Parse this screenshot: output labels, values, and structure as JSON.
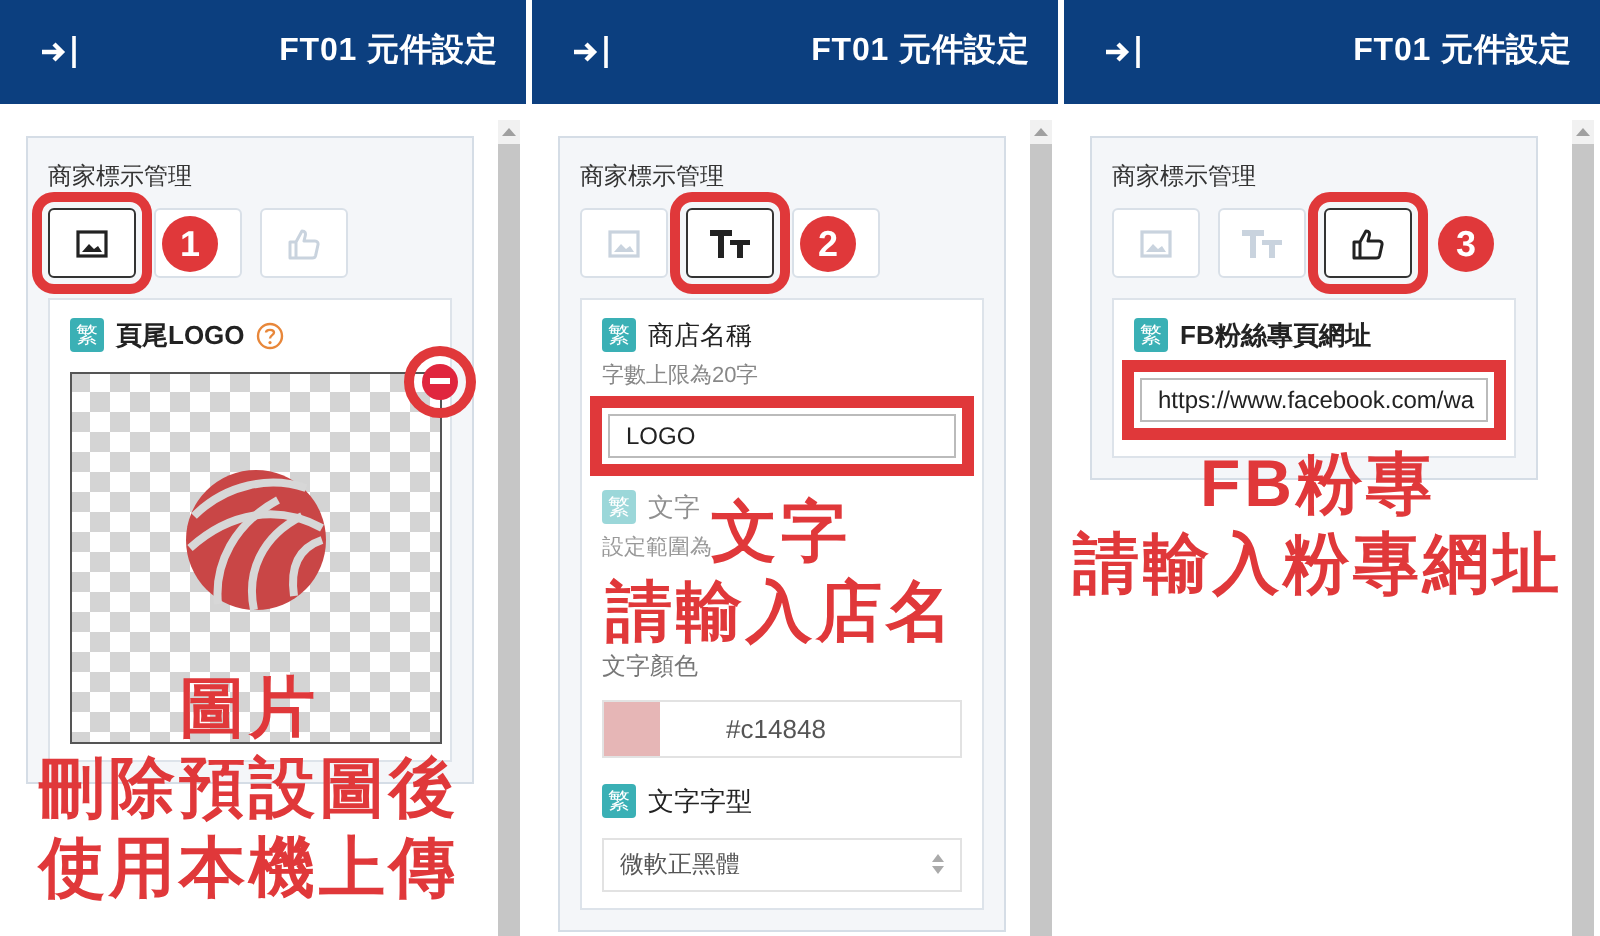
{
  "panels": [
    {
      "header_title": "FT01 元件設定",
      "section_title": "商家標示管理",
      "step": "1",
      "tabs": [
        {
          "kind": "image",
          "selected": true
        },
        {
          "kind": "text",
          "selected": false
        },
        {
          "kind": "like",
          "selected": false
        }
      ],
      "fields": [
        {
          "kind": "image_upload",
          "tag": "繁",
          "label": "頁尾LOGO",
          "strong": true,
          "help": true,
          "highlighted": true
        }
      ],
      "captions": [
        "圖片",
        "刪除預設圖後",
        "使用本機上傳"
      ]
    },
    {
      "header_title": "FT01 元件設定",
      "section_title": "商家標示管理",
      "step": "2",
      "tabs": [
        {
          "kind": "image",
          "selected": false
        },
        {
          "kind": "text",
          "selected": true
        },
        {
          "kind": "like",
          "selected": false
        }
      ],
      "fields": [
        {
          "kind": "text_input",
          "tag": "繁",
          "label": "商店名稱",
          "strong": false,
          "hint": "字數上限為20字",
          "value": "LOGO",
          "highlighted": true
        },
        {
          "kind": "number",
          "tag": "繁",
          "label": "文字",
          "strong": false,
          "hint": "設定範圍為",
          "disabled": true
        },
        {
          "kind": "color",
          "label": "文字顏色",
          "value": "#c14848"
        },
        {
          "kind": "select",
          "tag": "繁",
          "label": "文字字型",
          "strong": false,
          "value": "微軟正黑體"
        }
      ],
      "captions": [
        "文字",
        "請輸入店名"
      ]
    },
    {
      "header_title": "FT01 元件設定",
      "section_title": "商家標示管理",
      "step": "3",
      "tabs": [
        {
          "kind": "image",
          "selected": false
        },
        {
          "kind": "text",
          "selected": false
        },
        {
          "kind": "like",
          "selected": true
        }
      ],
      "fields": [
        {
          "kind": "text_input",
          "tag": "繁",
          "label": "FB粉絲專頁網址",
          "strong": true,
          "value": "https://www.facebook.com/wa",
          "highlighted": true
        }
      ],
      "captions": [
        "FB粉專",
        "請輸入粉專網址"
      ]
    }
  ]
}
